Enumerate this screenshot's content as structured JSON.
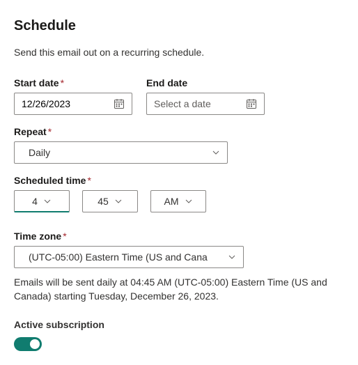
{
  "heading": "Schedule",
  "subtitle": "Send this email out on a recurring schedule.",
  "start_date": {
    "label": "Start date",
    "value": "12/26/2023",
    "required": true
  },
  "end_date": {
    "label": "End date",
    "placeholder": "Select a date",
    "value": "",
    "required": false
  },
  "repeat": {
    "label": "Repeat",
    "value": "Daily",
    "required": true
  },
  "scheduled_time": {
    "label": "Scheduled time",
    "hour": "4",
    "minute": "45",
    "ampm": "AM",
    "required": true
  },
  "timezone": {
    "label": "Time zone",
    "value": "(UTC-05:00) Eastern Time (US and Cana",
    "required": true
  },
  "summary": "Emails will be sent daily at 04:45 AM (UTC-05:00) Eastern Time (US and Canada) starting Tuesday, December 26, 2023.",
  "active_subscription": {
    "label": "Active subscription",
    "enabled": true
  }
}
